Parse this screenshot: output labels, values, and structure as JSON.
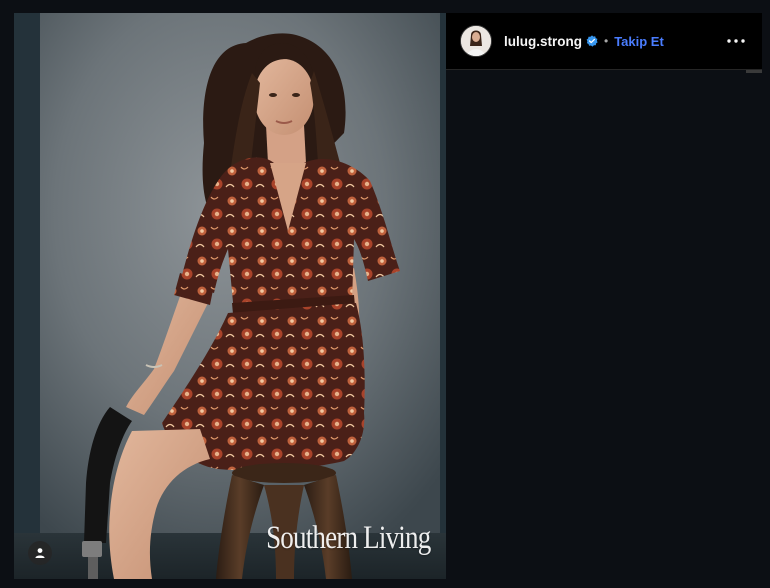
{
  "post": {
    "username": "lulug.strong",
    "follow_label": "Takip Et",
    "separator": "•",
    "watermark": "Southern Living"
  },
  "icons": {
    "verified": "verified-badge-icon",
    "more": "more-options-icon",
    "tagged_people": "user-tag-icon"
  },
  "colors": {
    "accent": "#4a7dff",
    "verified": "#3797f0",
    "background": "#0c0f14"
  }
}
